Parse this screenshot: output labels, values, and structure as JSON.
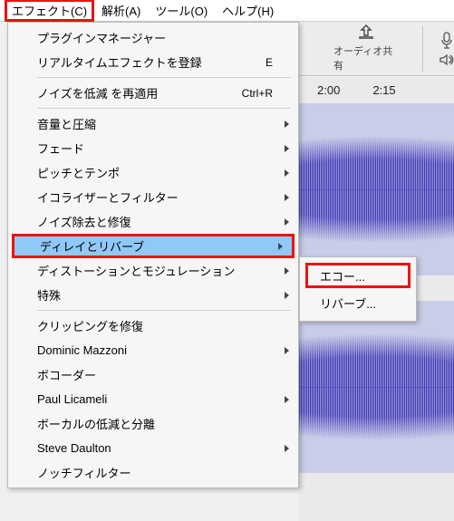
{
  "menubar": {
    "effect": "エフェクト(C)",
    "analyze": "解析(A)",
    "tools": "ツール(O)",
    "help": "ヘルプ(H)"
  },
  "menu": {
    "plugin_manager": "プラグインマネージャー",
    "register_realtime": "リアルタイムエフェクトを登録",
    "register_realtime_accel": "E",
    "reapply_denoise": "ノイズを低減 を再適用",
    "reapply_denoise_accel": "Ctrl+R",
    "volume_compress": "音量と圧縮",
    "fade": "フェード",
    "pitch_tempo": "ピッチとテンポ",
    "eq_filter": "イコライザーとフィルター",
    "denoise_restore": "ノイズ除去と修復",
    "delay_reverb": "ディレイとリバーブ",
    "distortion_mod": "ディストーションとモジュレーション",
    "special": "特殊",
    "clipping_restore": "クリッピングを修復",
    "dominic": "Dominic Mazzoni",
    "vocoder": "ボコーダー",
    "paul": "Paul Licameli",
    "vocal_reduce": "ボーカルの低減と分離",
    "steve": "Steve Daulton",
    "notch": "ノッチフィルター"
  },
  "submenu": {
    "echo": "エコー...",
    "reverb": "リバーブ..."
  },
  "toolbar": {
    "share": "オーディオ共有"
  },
  "timeline": {
    "t0": "2:00",
    "t1": "2:15"
  }
}
